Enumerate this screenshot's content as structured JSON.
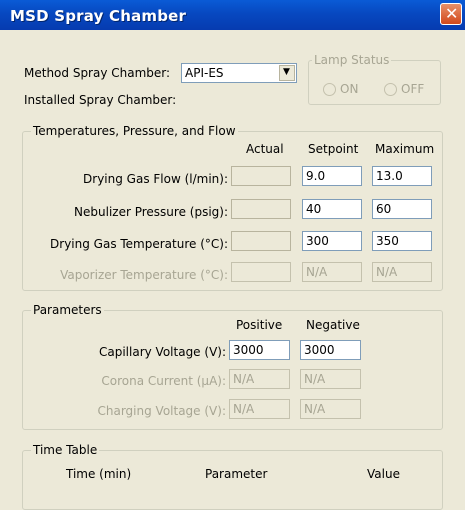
{
  "window": {
    "title": "MSD Spray Chamber",
    "close_glyph": "✕"
  },
  "method": {
    "label": "Method Spray Chamber:",
    "selected": "API-ES",
    "installed_label": "Installed Spray Chamber:"
  },
  "lamp": {
    "title": "Lamp Status",
    "on": "ON",
    "off": "OFF"
  },
  "tpf": {
    "title": "Temperatures, Pressure, and Flow",
    "col_actual": "Actual",
    "col_setpoint": "Setpoint",
    "col_maximum": "Maximum",
    "rows": [
      {
        "label": "Drying Gas Flow (l/min):",
        "actual": "",
        "setpoint": "9.0",
        "maximum": "13.0"
      },
      {
        "label": "Nebulizer Pressure (psig):",
        "actual": "",
        "setpoint": "40",
        "maximum": "60"
      },
      {
        "label": "Drying Gas Temperature (°C):",
        "actual": "",
        "setpoint": "300",
        "maximum": "350"
      },
      {
        "label": "Vaporizer Temperature (°C):",
        "actual": "",
        "setpoint": "N/A",
        "maximum": "N/A"
      }
    ]
  },
  "params": {
    "title": "Parameters",
    "col_positive": "Positive",
    "col_negative": "Negative",
    "rows": [
      {
        "label": "Capillary Voltage (V):",
        "positive": "3000",
        "negative": "3000"
      },
      {
        "label": "Corona Current (µA):",
        "positive": "N/A",
        "negative": "N/A"
      },
      {
        "label": "Charging Voltage (V):",
        "positive": "N/A",
        "negative": "N/A"
      }
    ]
  },
  "timetable": {
    "title": "Time Table",
    "col_time": "Time (min)",
    "col_parameter": "Parameter",
    "col_value": "Value"
  }
}
